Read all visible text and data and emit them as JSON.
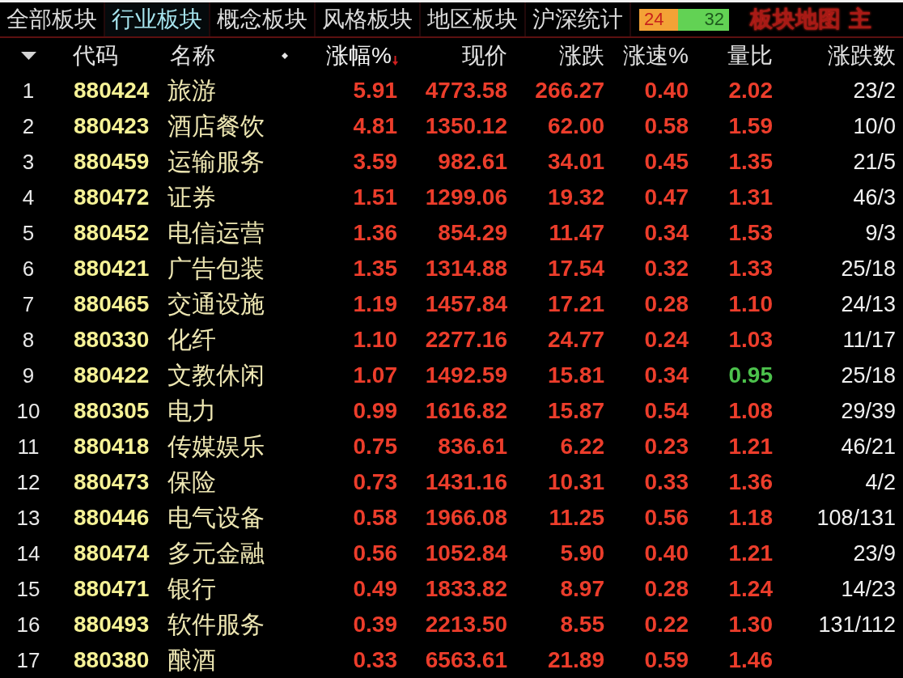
{
  "tabs": [
    {
      "label": "全部板块",
      "selected": false
    },
    {
      "label": "行业板块",
      "selected": true
    },
    {
      "label": "概念板块",
      "selected": false
    },
    {
      "label": "风格板块",
      "selected": false
    },
    {
      "label": "地区板块",
      "selected": false
    },
    {
      "label": "沪深统计",
      "selected": false
    }
  ],
  "breadth": {
    "up": "24",
    "down": "32",
    "level": 0.43
  },
  "links": [
    "板块地图",
    "主"
  ],
  "columns": [
    {
      "label": "代码",
      "sorted": false
    },
    {
      "label": "名称",
      "sorted": false
    },
    {
      "label": "涨幅%",
      "sorted": true
    },
    {
      "label": "现价",
      "sorted": false
    },
    {
      "label": "涨跌",
      "sorted": false
    },
    {
      "label": "涨速%",
      "sorted": false
    },
    {
      "label": "量比",
      "sorted": false
    },
    {
      "label": "涨跌数",
      "sorted": false
    }
  ],
  "rows": [
    {
      "no": "1",
      "code": "880424",
      "name": "旅游",
      "change_pct": "5.91",
      "price": "4773.58",
      "change": "266.27",
      "speed_pct": "0.40",
      "volume_ratio": {
        "value": "2.02",
        "color": "#ec3d2b"
      },
      "up_down": "23/2"
    },
    {
      "no": "2",
      "code": "880423",
      "name": "酒店餐饮",
      "change_pct": "4.81",
      "price": "1350.12",
      "change": "62.00",
      "speed_pct": "0.58",
      "volume_ratio": {
        "value": "1.59",
        "color": "#ec3d2b"
      },
      "up_down": "10/0"
    },
    {
      "no": "3",
      "code": "880459",
      "name": "运输服务",
      "change_pct": "3.59",
      "price": "982.61",
      "change": "34.01",
      "speed_pct": "0.45",
      "volume_ratio": {
        "value": "1.35",
        "color": "#ec3d2b"
      },
      "up_down": "21/5"
    },
    {
      "no": "4",
      "code": "880472",
      "name": "证券",
      "change_pct": "1.51",
      "price": "1299.06",
      "change": "19.32",
      "speed_pct": "0.47",
      "volume_ratio": {
        "value": "1.31",
        "color": "#ec3d2b"
      },
      "up_down": "46/3"
    },
    {
      "no": "5",
      "code": "880452",
      "name": "电信运营",
      "change_pct": "1.36",
      "price": "854.29",
      "change": "11.47",
      "speed_pct": "0.34",
      "volume_ratio": {
        "value": "1.53",
        "color": "#ec3d2b"
      },
      "up_down": "9/3"
    },
    {
      "no": "6",
      "code": "880421",
      "name": "广告包装",
      "change_pct": "1.35",
      "price": "1314.88",
      "change": "17.54",
      "speed_pct": "0.32",
      "volume_ratio": {
        "value": "1.33",
        "color": "#ec3d2b"
      },
      "up_down": "25/18"
    },
    {
      "no": "7",
      "code": "880465",
      "name": "交通设施",
      "change_pct": "1.19",
      "price": "1457.84",
      "change": "17.21",
      "speed_pct": "0.28",
      "volume_ratio": {
        "value": "1.10",
        "color": "#ec3d2b"
      },
      "up_down": "24/13"
    },
    {
      "no": "8",
      "code": "880330",
      "name": "化纤",
      "change_pct": "1.10",
      "price": "2277.16",
      "change": "24.77",
      "speed_pct": "0.24",
      "volume_ratio": {
        "value": "1.03",
        "color": "#ec3d2b"
      },
      "up_down": "11/17"
    },
    {
      "no": "9",
      "code": "880422",
      "name": "文教休闲",
      "change_pct": "1.07",
      "price": "1492.59",
      "change": "15.81",
      "speed_pct": "0.34",
      "volume_ratio": {
        "value": "0.95",
        "color": "#4cc24c"
      },
      "up_down": "25/18"
    },
    {
      "no": "10",
      "code": "880305",
      "name": "电力",
      "change_pct": "0.99",
      "price": "1616.82",
      "change": "15.87",
      "speed_pct": "0.54",
      "volume_ratio": {
        "value": "1.08",
        "color": "#ec3d2b"
      },
      "up_down": "29/39"
    },
    {
      "no": "11",
      "code": "880418",
      "name": "传媒娱乐",
      "change_pct": "0.75",
      "price": "836.61",
      "change": "6.22",
      "speed_pct": "0.23",
      "volume_ratio": {
        "value": "1.21",
        "color": "#ec3d2b"
      },
      "up_down": "46/21"
    },
    {
      "no": "12",
      "code": "880473",
      "name": "保险",
      "change_pct": "0.73",
      "price": "1431.16",
      "change": "10.31",
      "speed_pct": "0.33",
      "volume_ratio": {
        "value": "1.36",
        "color": "#ec3d2b"
      },
      "up_down": "4/2"
    },
    {
      "no": "13",
      "code": "880446",
      "name": "电气设备",
      "change_pct": "0.58",
      "price": "1966.08",
      "change": "11.25",
      "speed_pct": "0.56",
      "volume_ratio": {
        "value": "1.18",
        "color": "#ec3d2b"
      },
      "up_down": "108/131"
    },
    {
      "no": "14",
      "code": "880474",
      "name": "多元金融",
      "change_pct": "0.56",
      "price": "1052.84",
      "change": "5.90",
      "speed_pct": "0.40",
      "volume_ratio": {
        "value": "1.21",
        "color": "#ec3d2b"
      },
      "up_down": "23/9"
    },
    {
      "no": "15",
      "code": "880471",
      "name": "银行",
      "change_pct": "0.49",
      "price": "1833.82",
      "change": "8.97",
      "speed_pct": "0.28",
      "volume_ratio": {
        "value": "1.24",
        "color": "#ec3d2b"
      },
      "up_down": "14/23"
    },
    {
      "no": "16",
      "code": "880493",
      "name": "软件服务",
      "change_pct": "0.39",
      "price": "2213.50",
      "change": "8.55",
      "speed_pct": "0.22",
      "volume_ratio": {
        "value": "1.30",
        "color": "#ec3d2b"
      },
      "up_down": "131/112"
    },
    {
      "no": "17",
      "code": "880380",
      "name": "酿酒",
      "change_pct": "0.33",
      "price": "6563.61",
      "change": "21.89",
      "speed_pct": "0.59",
      "volume_ratio": {
        "value": "1.46",
        "color": "#ec3d2b"
      }
    }
  ]
}
